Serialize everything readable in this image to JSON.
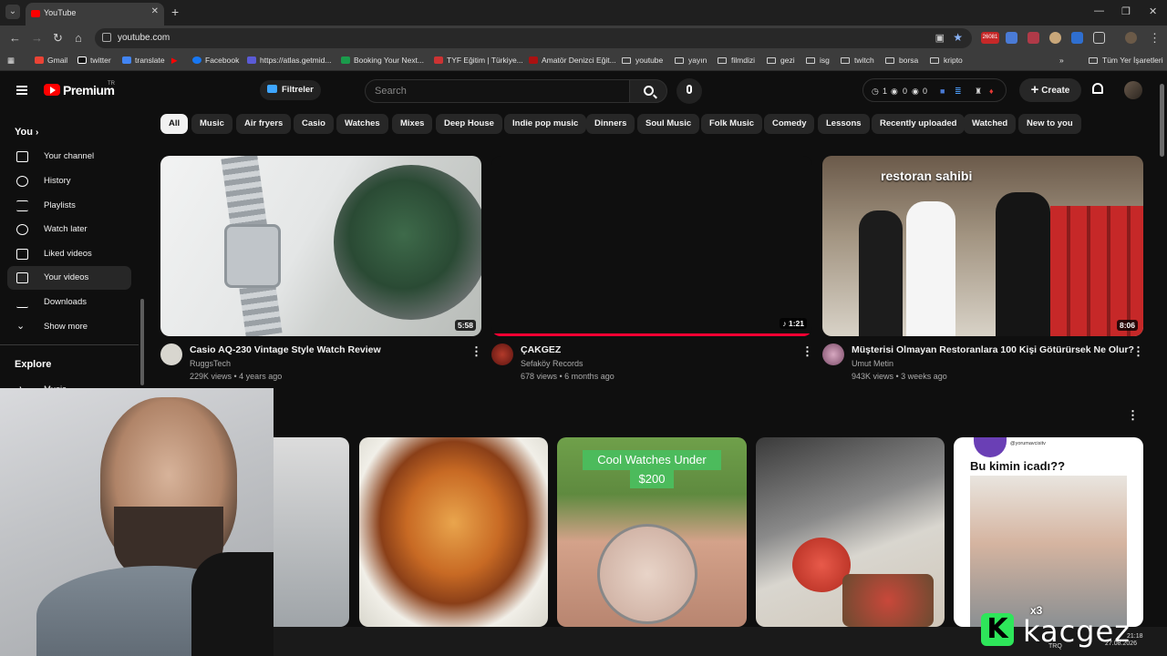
{
  "browser": {
    "tab_title": "YouTube",
    "url": "youtube.com",
    "bookmarks": [
      "Gmail",
      "twitter",
      "translate",
      "Facebook",
      "https://atlas.getmid...",
      "Booking Your Next...",
      "TYF Eğitim | Türkiye...",
      "Amatör Denizci Eğit...",
      "youtube",
      "yayın",
      "filmdizi",
      "gezi",
      "isg",
      "twitch",
      "borsa",
      "kripto"
    ],
    "other_bookmarks": "Tüm Yer İşaretleri",
    "ext_badge": "26081"
  },
  "header": {
    "brand": "Premium",
    "region": "TR",
    "filters_label": "Filtreler",
    "search_placeholder": "Search",
    "stats": [
      "1",
      "0",
      "0"
    ],
    "create_label": "Create"
  },
  "sidebar": {
    "you_label": "You",
    "items": [
      {
        "label": "Your channel",
        "icon": "person-icon"
      },
      {
        "label": "History",
        "icon": "history-icon"
      },
      {
        "label": "Playlists",
        "icon": "playlist-icon"
      },
      {
        "label": "Watch later",
        "icon": "clock-icon"
      },
      {
        "label": "Liked videos",
        "icon": "thumb-up-icon"
      },
      {
        "label": "Your videos",
        "icon": "play-icon"
      },
      {
        "label": "Downloads",
        "icon": "download-icon"
      },
      {
        "label": "Show more",
        "icon": "chevron-down-icon"
      }
    ],
    "explore_label": "Explore",
    "explore_items": [
      "Music"
    ]
  },
  "chips": [
    "All",
    "Music",
    "Air fryers",
    "Casio",
    "Watches",
    "Mixes",
    "Deep House",
    "Indie pop music",
    "Dinners",
    "Soul Music",
    "Folk Music",
    "Comedy",
    "Lessons",
    "Recently uploaded",
    "Watched",
    "New to you"
  ],
  "videos": [
    {
      "title": "Casio AQ-230 Vintage Style Watch Review",
      "channel": "RuggsTech",
      "meta": "229K views • 4 years ago",
      "duration": "5:58"
    },
    {
      "title": "ÇAKGEZ",
      "channel": "Sefaköy Records",
      "meta": "678 views • 6 months ago",
      "duration": "♪ 1:21"
    },
    {
      "title": "Müşterisi Olmayan Restoranlara 100 Kişi Götürürsek Ne Olur?",
      "channel": "Umut Metin",
      "meta": "943K views • 3 weeks ago",
      "duration": "8:06",
      "overlay": "restoran sahibi"
    }
  ],
  "row2": {
    "watch_overlay_line1": "Cool Watches Under",
    "watch_overlay_line2": "$200",
    "short_overlay": "Bu kimin icadı??",
    "short_handle": "@yorumavcisitv",
    "short_badge": "x3"
  },
  "stream": {
    "brand_letter": "K",
    "brand_name": "kacgez",
    "clock_time": "21:18",
    "clock_date": "27.08.2026",
    "lang": "TRQ"
  },
  "colors": {
    "accent": "#ff0000",
    "progress": "#ff0033",
    "link": "#3ea6ff"
  }
}
